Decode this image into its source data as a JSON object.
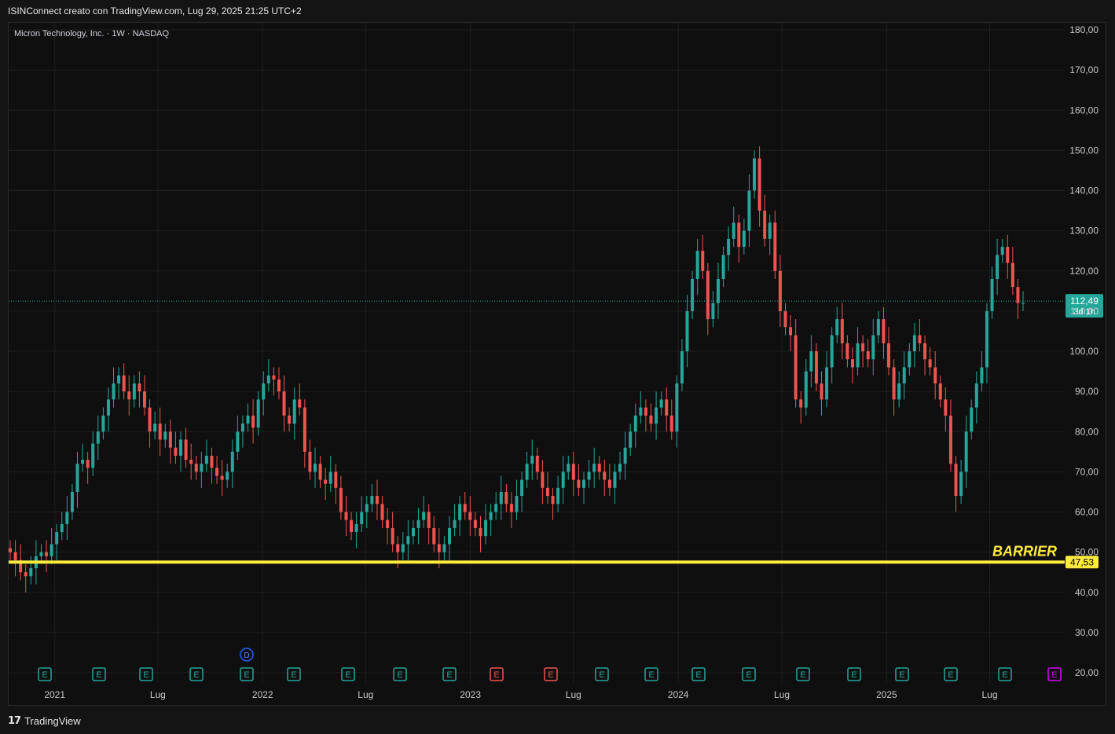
{
  "header": {
    "text": "ISINConnect creato con TradingView.com, Lug 29, 2025 21:25 UTC+2"
  },
  "footer": {
    "logo_text": "TradingView"
  },
  "colors": {
    "up": "#26a69a",
    "down": "#ef5350",
    "barrier": "#ffeb3b",
    "current_price": "#26a69a",
    "grid": "#1e1e1e"
  },
  "chart_data": {
    "type": "candlestick",
    "title": "Micron Technology, Inc. · 1W · NASDAQ",
    "y_axis": {
      "ticks": [
        "180,00",
        "170,00",
        "160,00",
        "150,00",
        "140,00",
        "130,00",
        "120,00",
        "110,00",
        "100,00",
        "90,00",
        "80,00",
        "70,00",
        "60,00",
        "50,00",
        "40,00",
        "30,00",
        "20,00"
      ],
      "ylim": [
        15,
        183
      ]
    },
    "x_axis": {
      "ticks": [
        "2021",
        "Lug",
        "2022",
        "Lug",
        "2023",
        "Lug",
        "2024",
        "Lug",
        "2025",
        "Lug"
      ],
      "start": "2020-10-12",
      "end": "2025-10-27"
    },
    "current_price": {
      "value": 112.49,
      "label": "112,49",
      "countdown": "3d 1h"
    },
    "barrier": {
      "value": 47.53,
      "label": "47,53",
      "text": "BARRIER"
    },
    "grid": true,
    "close_series": [
      50,
      48,
      45,
      44,
      46,
      49,
      50,
      49,
      52,
      55,
      57,
      60,
      65,
      72,
      73,
      71,
      77,
      80,
      84,
      88,
      92,
      94,
      90,
      88,
      92,
      90,
      86,
      80,
      82,
      78,
      80,
      76,
      74,
      78,
      73,
      72,
      70,
      72,
      74,
      71,
      69,
      68,
      70,
      75,
      80,
      82,
      84,
      81,
      88,
      92,
      94,
      93,
      90,
      84,
      82,
      88,
      86,
      75,
      70,
      72,
      68,
      67,
      70,
      66,
      60,
      58,
      55,
      57,
      60,
      62,
      64,
      62,
      58,
      56,
      52,
      50,
      52,
      54,
      56,
      58,
      60,
      56,
      52,
      50,
      52,
      56,
      58,
      62,
      60,
      58,
      56,
      54,
      58,
      60,
      62,
      65,
      62,
      60,
      64,
      68,
      72,
      74,
      70,
      66,
      64,
      62,
      66,
      70,
      72,
      68,
      66,
      68,
      70,
      72,
      70,
      68,
      66,
      70,
      72,
      76,
      80,
      84,
      86,
      84,
      82,
      86,
      88,
      84,
      80,
      92,
      100,
      110,
      118,
      125,
      120,
      108,
      112,
      118,
      124,
      128,
      132,
      126,
      130,
      140,
      148,
      135,
      128,
      132,
      120,
      110,
      106,
      104,
      88,
      86,
      95,
      100,
      92,
      88,
      96,
      104,
      108,
      102,
      98,
      96,
      102,
      100,
      98,
      104,
      108,
      102,
      96,
      88,
      92,
      96,
      100,
      104,
      102,
      98,
      96,
      92,
      88,
      84,
      72,
      64,
      70,
      80,
      86,
      92,
      96,
      110,
      118,
      124,
      126,
      122,
      116,
      112,
      112
    ],
    "event_labels": {
      "earnings": "E",
      "dividend": "D"
    }
  }
}
